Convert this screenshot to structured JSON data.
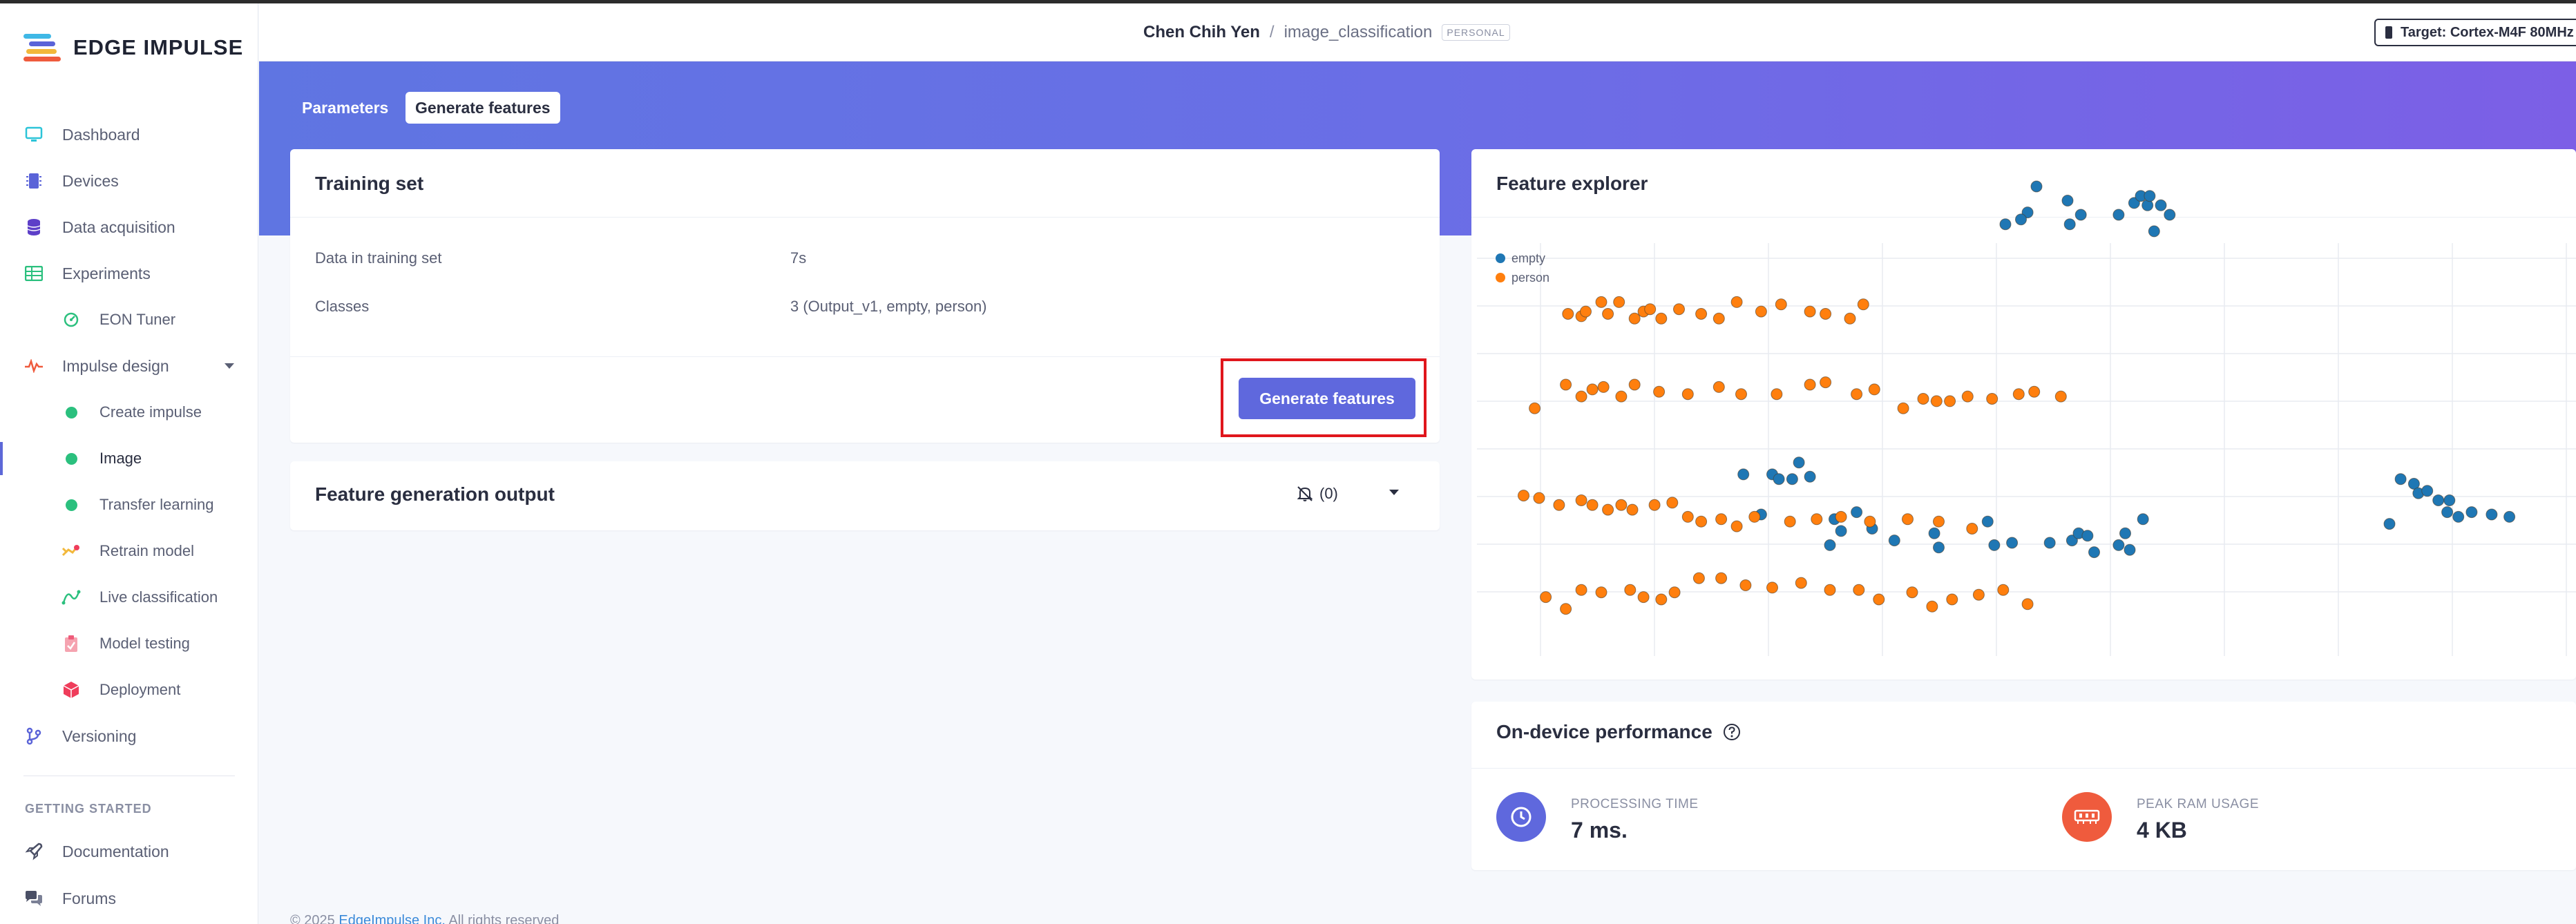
{
  "brand": {
    "name": "EDGE IMPULSE"
  },
  "sidebar": {
    "items": [
      {
        "label": "Dashboard",
        "icon": "monitor-icon"
      },
      {
        "label": "Devices",
        "icon": "chip-icon"
      },
      {
        "label": "Data acquisition",
        "icon": "database-icon"
      },
      {
        "label": "Experiments",
        "icon": "table-icon"
      },
      {
        "label": "EON Tuner",
        "icon": "tuner-icon"
      },
      {
        "label": "Impulse design",
        "icon": "pulse-icon"
      },
      {
        "label": "Create impulse",
        "icon": "dot-icon"
      },
      {
        "label": "Image",
        "icon": "dot-icon"
      },
      {
        "label": "Transfer learning",
        "icon": "dot-icon"
      },
      {
        "label": "Retrain model",
        "icon": "retrain-icon"
      },
      {
        "label": "Live classification",
        "icon": "live-icon"
      },
      {
        "label": "Model testing",
        "icon": "clipboard-icon"
      },
      {
        "label": "Deployment",
        "icon": "cube-icon"
      },
      {
        "label": "Versioning",
        "icon": "branch-icon"
      }
    ],
    "getting_started_heading": "GETTING STARTED",
    "getting_started": [
      {
        "label": "Documentation",
        "icon": "rocket-icon"
      },
      {
        "label": "Forums",
        "icon": "chat-icon"
      }
    ]
  },
  "header": {
    "user": "Chen Chih Yen",
    "separator": "/",
    "project": "image_classification",
    "badge": "PERSONAL",
    "target": "Target: Cortex-M4F 80MHz"
  },
  "tabs": {
    "parameters": "Parameters",
    "generate": "Generate features"
  },
  "training_set": {
    "title": "Training set",
    "rows": [
      {
        "key": "Data in training set",
        "value": "7s"
      },
      {
        "key": "Classes",
        "value": "3 (Output_v1, empty, person)"
      }
    ],
    "button": "Generate features"
  },
  "output": {
    "title": "Feature generation output",
    "count": "(0)"
  },
  "explorer": {
    "title": "Feature explorer",
    "colors": {
      "empty": "#1f77b4",
      "person": "#ff7f0e"
    },
    "chart_data": {
      "type": "scatter",
      "title": "Feature explorer",
      "legend": "top-left",
      "grid": true,
      "series": [
        {
          "name": "empty",
          "points": [
            [
              1043,
              262
            ],
            [
              1053,
              257
            ],
            [
              1057,
              246
            ],
            [
              1050,
              260
            ],
            [
              1071,
              252
            ],
            [
              1072,
              262
            ],
            [
              1077,
              258
            ],
            [
              1094,
              258
            ],
            [
              1101,
              253
            ],
            [
              1104,
              250
            ],
            [
              1107,
              254
            ],
            [
              1108,
              250
            ],
            [
              1117,
              258
            ],
            [
              1110,
              265
            ],
            [
              1113,
              254
            ],
            [
              925,
              368
            ],
            [
              938,
              368
            ],
            [
              950,
              363
            ],
            [
              955,
              369
            ],
            [
              947,
              370
            ],
            [
              941,
              370
            ],
            [
              933,
              385
            ],
            [
              966,
              387
            ],
            [
              964,
              398
            ],
            [
              969,
              392
            ],
            [
              976,
              384
            ],
            [
              983,
              391
            ],
            [
              993,
              396
            ],
            [
              1011,
              393
            ],
            [
              1013,
              399
            ],
            [
              1035,
              388
            ],
            [
              1038,
              398
            ],
            [
              1046,
              397
            ],
            [
              1063,
              397
            ],
            [
              1073,
              396
            ],
            [
              1076,
              393
            ],
            [
              1080,
              394
            ],
            [
              1083,
              401
            ],
            [
              1094,
              398
            ],
            [
              1097,
              393
            ],
            [
              1099,
              400
            ],
            [
              1105,
              387
            ],
            [
              1216,
              389
            ],
            [
              1221,
              370
            ],
            [
              1227,
              372
            ],
            [
              1229,
              376
            ],
            [
              1233,
              375
            ],
            [
              1238,
              379
            ],
            [
              1243,
              379
            ],
            [
              1242,
              384
            ],
            [
              1247,
              386
            ],
            [
              1253,
              384
            ],
            [
              1262,
              385
            ],
            [
              1270,
              386
            ]
          ]
        },
        {
          "name": "person",
          "points": [
            [
              846,
              300
            ],
            [
              852,
              301
            ],
            [
              854,
              299
            ],
            [
              861,
              295
            ],
            [
              864,
              300
            ],
            [
              869,
              295
            ],
            [
              876,
              302
            ],
            [
              880,
              299
            ],
            [
              883,
              298
            ],
            [
              888,
              302
            ],
            [
              896,
              298
            ],
            [
              906,
              300
            ],
            [
              914,
              302
            ],
            [
              922,
              295
            ],
            [
              933,
              299
            ],
            [
              942,
              296
            ],
            [
              955,
              299
            ],
            [
              962,
              300
            ],
            [
              973,
              302
            ],
            [
              979,
              296
            ],
            [
              831,
              340
            ],
            [
              845,
              330
            ],
            [
              852,
              335
            ],
            [
              857,
              332
            ],
            [
              862,
              331
            ],
            [
              870,
              335
            ],
            [
              876,
              330
            ],
            [
              887,
              333
            ],
            [
              900,
              334
            ],
            [
              914,
              331
            ],
            [
              924,
              334
            ],
            [
              940,
              334
            ],
            [
              955,
              330
            ],
            [
              962,
              329
            ],
            [
              976,
              334
            ],
            [
              984,
              332
            ],
            [
              997,
              340
            ],
            [
              1006,
              336
            ],
            [
              1012,
              337
            ],
            [
              1018,
              337
            ],
            [
              1026,
              335
            ],
            [
              1037,
              336
            ],
            [
              1049,
              334
            ],
            [
              1056,
              333
            ],
            [
              1068,
              335
            ],
            [
              826,
              377
            ],
            [
              833,
              378
            ],
            [
              842,
              381
            ],
            [
              852,
              379
            ],
            [
              857,
              381
            ],
            [
              864,
              383
            ],
            [
              870,
              381
            ],
            [
              875,
              383
            ],
            [
              885,
              381
            ],
            [
              893,
              380
            ],
            [
              900,
              386
            ],
            [
              906,
              388
            ],
            [
              915,
              387
            ],
            [
              922,
              390
            ],
            [
              930,
              386
            ],
            [
              946,
              388
            ],
            [
              958,
              387
            ],
            [
              969,
              386
            ],
            [
              982,
              388
            ],
            [
              999,
              387
            ],
            [
              1013,
              388
            ],
            [
              1028,
              391
            ],
            [
              836,
              420
            ],
            [
              845,
              425
            ],
            [
              852,
              417
            ],
            [
              861,
              418
            ],
            [
              874,
              417
            ],
            [
              880,
              420
            ],
            [
              888,
              421
            ],
            [
              894,
              418
            ],
            [
              905,
              412
            ],
            [
              915,
              412
            ],
            [
              926,
              415
            ],
            [
              938,
              416
            ],
            [
              951,
              414
            ],
            [
              964,
              417
            ],
            [
              977,
              417
            ],
            [
              986,
              421
            ],
            [
              1001,
              418
            ],
            [
              1010,
              424
            ],
            [
              1019,
              421
            ],
            [
              1031,
              419
            ],
            [
              1042,
              417
            ],
            [
              1053,
              423
            ]
          ]
        },
        {
          "name": "empty",
          "points": []
        }
      ]
    }
  },
  "performance": {
    "title": "On-device performance",
    "processing_label": "PROCESSING TIME",
    "processing_value": "7 ms.",
    "ram_label": "PEAK RAM USAGE",
    "ram_value": "4 KB"
  },
  "footer": {
    "prefix": "© 2025",
    "company": "EdgeImpulse Inc.",
    "suffix": "All rights reserved"
  }
}
